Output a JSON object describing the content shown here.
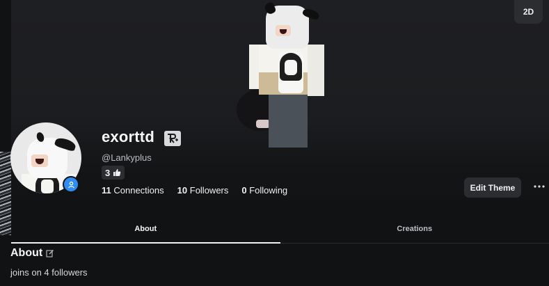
{
  "view_toggle": {
    "label": "2D"
  },
  "profile": {
    "display_name": "exorttd",
    "username": "@Lankyplus",
    "likes": "3",
    "presence_status": "online",
    "stats": [
      {
        "count": "11",
        "label": "Connections"
      },
      {
        "count": "10",
        "label": "Followers"
      },
      {
        "count": "0",
        "label": "Following"
      }
    ]
  },
  "actions": {
    "edit_theme_label": "Edit Theme"
  },
  "tabs": [
    {
      "label": "About",
      "active": true
    },
    {
      "label": "Creations",
      "active": false
    }
  ],
  "about": {
    "title": "About",
    "text": "joins on 4 followers"
  },
  "colors": {
    "background": "#111214",
    "button": "#2b2d31",
    "presence": "#2f8cf5",
    "text": "#f1f1f2"
  },
  "icons": {
    "verified": "verified-badge-icon",
    "like": "thumbs-up-icon",
    "presence": "user-icon",
    "more": "more-horizontal-icon",
    "edit": "edit-icon"
  }
}
